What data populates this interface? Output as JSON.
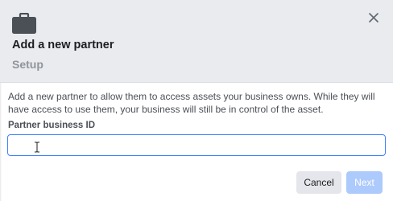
{
  "dialog": {
    "title": "Add a new partner",
    "subtitle": "Setup",
    "header_icon": "briefcase-icon",
    "close_icon": "close-icon"
  },
  "body": {
    "description": "Add a new partner to allow them to access assets your business owns. While they will have access to use them, your business will still be in control of the asset.",
    "field_label": "Partner business ID",
    "field_value": "",
    "field_placeholder": ""
  },
  "footer": {
    "cancel_label": "Cancel",
    "next_label": "Next"
  },
  "colors": {
    "header_bg": "#e9ebee",
    "input_focus_border": "#4080ff",
    "next_disabled_bg": "#adcafc",
    "cancel_bg": "#e4e6eb"
  }
}
